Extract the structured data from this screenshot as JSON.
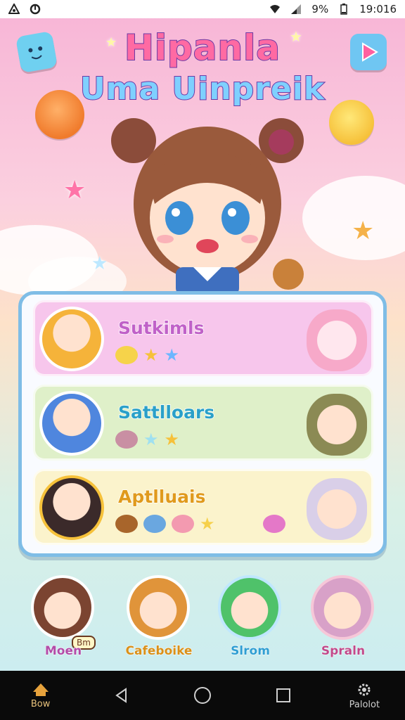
{
  "statusbar": {
    "battery": "9%",
    "time": "19:016"
  },
  "title": {
    "line1": "Hipanla",
    "line2": "Uma Uinpreik"
  },
  "list": [
    {
      "label": "Sutkimls",
      "color": "#c061c8",
      "bg": "#f7c6ec"
    },
    {
      "label": "Sattlloars",
      "color": "#2aa0c8",
      "bg": "#dff0c9"
    },
    {
      "label": "Aptlluais",
      "color": "#e09a1c",
      "bg": "#fbf3cc"
    }
  ],
  "bottom_chars": [
    {
      "badge": "Bm",
      "name": "Moen"
    },
    {
      "name": "Cafeboike"
    },
    {
      "name": "Slrom"
    },
    {
      "name": "Spraln"
    }
  ],
  "navbar": {
    "home_label": "Bow",
    "settings_label": "Palolot"
  },
  "colors": {
    "accent": "#7fbde6",
    "title_stroke": "#6b3aa5",
    "navbar_bg": "#0a0a0a"
  }
}
